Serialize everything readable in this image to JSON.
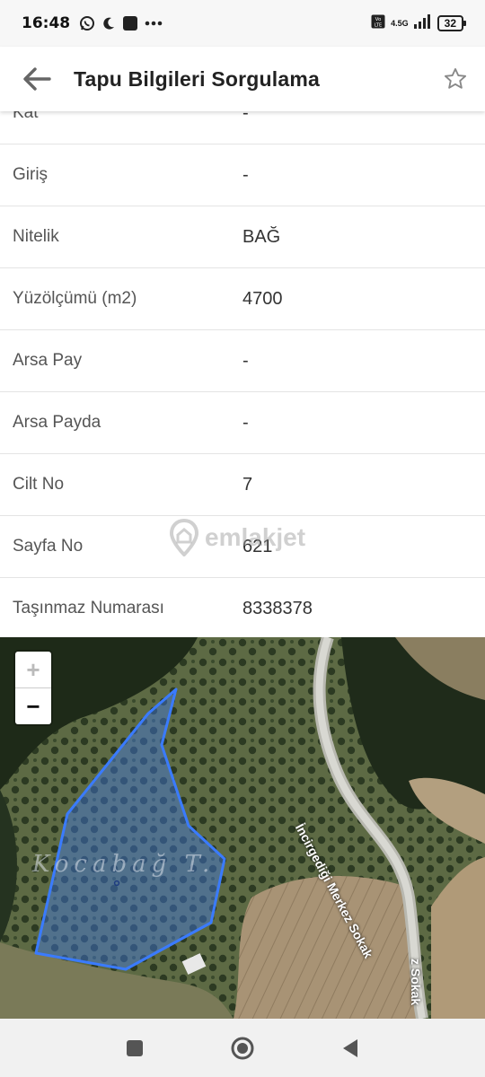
{
  "status": {
    "time": "16:48",
    "network": "4.5G",
    "volte": "VoLTE",
    "battery": "32"
  },
  "app_bar": {
    "title": "Tapu Bilgileri Sorgulama"
  },
  "rows": [
    {
      "label": "Kat",
      "value": "-"
    },
    {
      "label": "Giriş",
      "value": "-"
    },
    {
      "label": "Nitelik",
      "value": "BAĞ"
    },
    {
      "label": "Yüzölçümü (m2)",
      "value": "4700"
    },
    {
      "label": "Arsa Pay",
      "value": "-"
    },
    {
      "label": "Arsa Payda",
      "value": "-"
    },
    {
      "label": "Cilt No",
      "value": "7"
    },
    {
      "label": "Sayfa No",
      "value": "621"
    },
    {
      "label": "Taşınmaz Numarası",
      "value": "8338378"
    }
  ],
  "watermark": "emlakjet",
  "map": {
    "zoom_in": "+",
    "zoom_out": "−",
    "place_label": "Kocabağ T.",
    "street_1": "İncirgediği Merkez Sokak",
    "street_2": "z Sokak",
    "parcel_color": "#3a7bff"
  }
}
